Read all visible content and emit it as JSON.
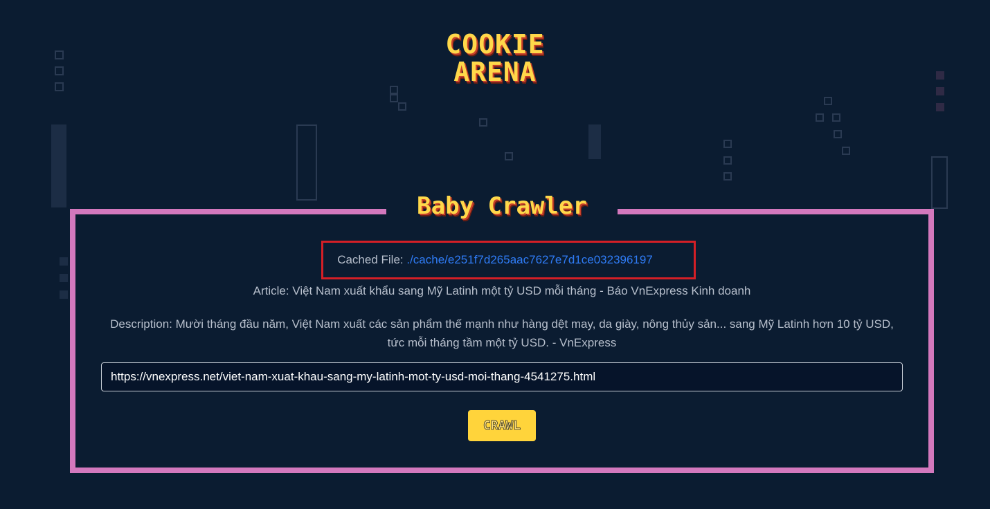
{
  "logo": {
    "line1": "COOKIE",
    "line2": "ARENA"
  },
  "panel": {
    "title": "Baby Crawler"
  },
  "result": {
    "cached_label": "Cached File: ",
    "cached_link": "./cache/e251f7d265aac7627e7d1ce032396197",
    "article": "Article: Việt Nam xuất khẩu sang Mỹ Latinh một tỷ USD mỗi tháng - Báo VnExpress Kinh doanh",
    "description": "Description: Mười tháng đầu năm, Việt Nam xuất các sản phẩm thế mạnh như hàng dệt may, da giày, nông thủy sản... sang Mỹ Latinh hơn 10 tỷ USD, tức mỗi tháng tầm một tỷ USD. - VnExpress"
  },
  "form": {
    "url_value": "https://vnexpress.net/viet-nam-xuat-khau-sang-my-latinh-mot-ty-usd-moi-thang-4541275.html",
    "crawl_label": "CRAWL"
  },
  "colors": {
    "background": "#0b1c31",
    "frame": "#d378bd",
    "accent_yellow": "#ffd43b",
    "link": "#2f7cf6",
    "highlight_box": "#d41f26"
  }
}
